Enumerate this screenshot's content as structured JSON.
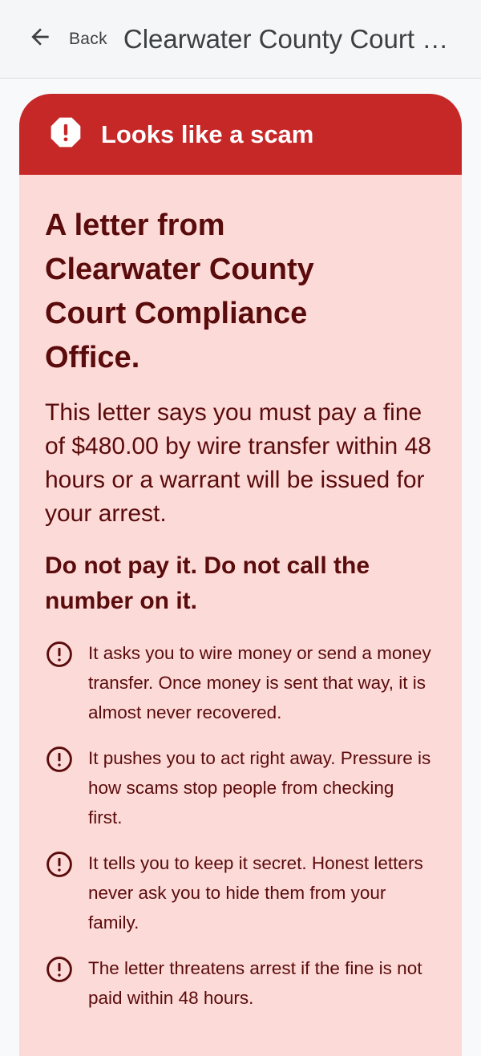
{
  "header": {
    "back_label": "Back",
    "title": "Clearwater County Court Compliance Office"
  },
  "banner": {
    "label": "Looks like a scam",
    "icon": "alert-octagon-icon",
    "color": "#c62828"
  },
  "card": {
    "headline": "A letter from Clearwater County Court Compliance Office.",
    "summary": "This letter says you must pay a fine of $480.00 by wire transfer within 48 hours or a warrant will be issued for your arrest.",
    "warning": "Do not pay it. Do not call the number on it.",
    "background_color": "#fcdad8",
    "text_color": "#5a0b0b",
    "reasons": [
      {
        "icon": "alert-circle-icon",
        "text": "It asks you to wire money or send a money transfer. Once money is sent that way, it is almost never recovered."
      },
      {
        "icon": "alert-circle-icon",
        "text": "It pushes you to act right away. Pressure is how scams stop people from checking first."
      },
      {
        "icon": "alert-circle-icon",
        "text": "It tells you to keep it secret. Honest letters never ask you to hide them from your family."
      },
      {
        "icon": "alert-circle-icon",
        "text": "The letter threatens arrest if the fine is not paid within 48 hours."
      }
    ]
  }
}
